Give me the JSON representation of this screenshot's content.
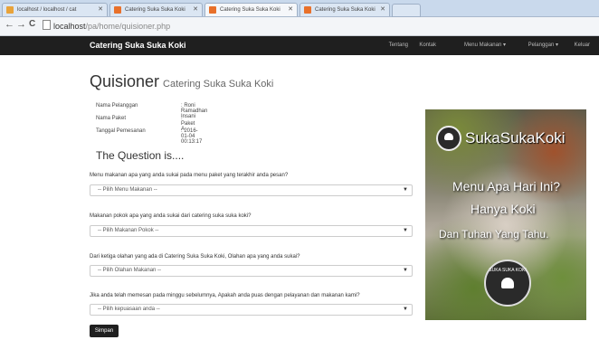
{
  "browser": {
    "tabs": [
      {
        "title": "localhost / localhost / cat",
        "active": false
      },
      {
        "title": "Catering Suka Suka Koki",
        "active": false
      },
      {
        "title": "Catering Suka Suka Koki",
        "active": true
      },
      {
        "title": "Catering Suka Suka Koki",
        "active": false
      }
    ],
    "url_host": "localhost",
    "url_path": "/pa/home/quisioner.php"
  },
  "navbar": {
    "brand": "Catering Suka Suka Koki",
    "menu": [
      "Tentang",
      "Kontak",
      "Menu Makanan ▾",
      "Pelanggan ▾",
      "Keluar"
    ]
  },
  "page": {
    "title": "Quisioner",
    "subtitle": "Catering Suka Suka Koki",
    "info": [
      {
        "label": "Nama Pelanggan",
        "value": ": Roni Ramadhan Insani"
      },
      {
        "label": "Nama Paket",
        "value": ": Paket A"
      },
      {
        "label": "Tanggal Pemesanan",
        "value": ": 2016-01-04 00:13:17"
      }
    ],
    "question_heading": "The Question is....",
    "questions": [
      {
        "text": "Menu makanan apa yang anda sukai pada menu paket yang terakhir anda pesan?",
        "placeholder": "-- Pilih Menu Makanan --"
      },
      {
        "text": "Makanan pokok apa yang anda sukai dari catering suka suka koki?",
        "placeholder": "-- Pilih Makanan Pokok --"
      },
      {
        "text": "Dari ketiga olahan yang ada di Catering Suka Suka Koki, Olahan apa yang anda sukai?",
        "placeholder": "-- Pilih Olahan Makanan --"
      },
      {
        "text": "Jika anda telah memesan pada minggu sebelumnya, Apakah anda puas dengan pelayanan dan makanan kami?",
        "placeholder": "-- Pilih kepuasaan anda --"
      }
    ],
    "submit_label": "Simpan"
  },
  "banner": {
    "brand": "SukaSukaKoki",
    "line1": "Menu Apa Hari Ini?",
    "line2": "Hanya Koki",
    "line3": "Dan Tuhan Yang Tahu.",
    "seal_text": "SUKA SUKA KOKI"
  }
}
